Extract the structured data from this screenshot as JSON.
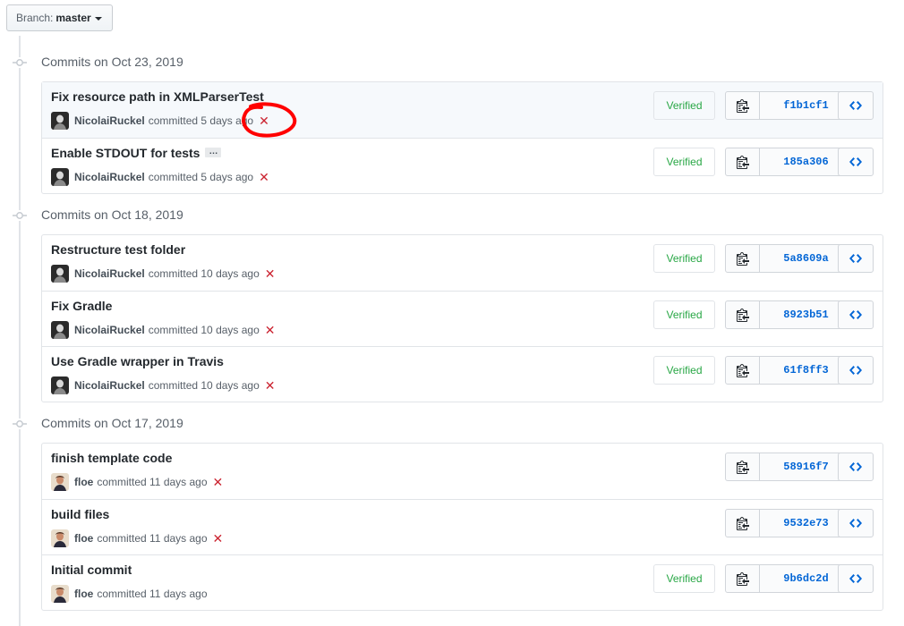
{
  "branch": {
    "prefix": "Branch:",
    "name": "master"
  },
  "groups": [
    {
      "title": "Commits on Oct 23, 2019",
      "commits": [
        {
          "message": "Fix resource path in XMLParserTest",
          "author": "NicolaiRuckel",
          "time": "committed 5 days ago",
          "failed": true,
          "verified": "Verified",
          "sha": "f1b1cf1",
          "avatar": "dark"
        },
        {
          "message": "Enable STDOUT for tests",
          "author": "NicolaiRuckel",
          "time": "committed 5 days ago",
          "failed": true,
          "verified": "Verified",
          "sha": "185a306",
          "avatar": "dark",
          "ellipsis": "…"
        }
      ]
    },
    {
      "title": "Commits on Oct 18, 2019",
      "commits": [
        {
          "message": "Restructure test folder",
          "author": "NicolaiRuckel",
          "time": "committed 10 days ago",
          "failed": true,
          "verified": "Verified",
          "sha": "5a8609a",
          "avatar": "dark"
        },
        {
          "message": "Fix Gradle",
          "author": "NicolaiRuckel",
          "time": "committed 10 days ago",
          "failed": true,
          "verified": "Verified",
          "sha": "8923b51",
          "avatar": "dark"
        },
        {
          "message": "Use Gradle wrapper in Travis",
          "author": "NicolaiRuckel",
          "time": "committed 10 days ago",
          "failed": true,
          "verified": "Verified",
          "sha": "61f8ff3",
          "avatar": "dark"
        }
      ]
    },
    {
      "title": "Commits on Oct 17, 2019",
      "commits": [
        {
          "message": "finish template code",
          "author": "floe",
          "time": "committed 11 days ago",
          "failed": true,
          "verified": "",
          "sha": "58916f7",
          "avatar": "light"
        },
        {
          "message": "build files",
          "author": "floe",
          "time": "committed 11 days ago",
          "failed": true,
          "verified": "",
          "sha": "9532e73",
          "avatar": "light"
        },
        {
          "message": "Initial commit",
          "author": "floe",
          "time": "committed 11 days ago",
          "failed": false,
          "verified": "Verified",
          "sha": "9b6dc2d",
          "avatar": "light"
        }
      ]
    }
  ],
  "icons": {
    "failure": "x-icon",
    "copy": "clippy-icon",
    "browse": "code-icon",
    "timeline": "git-commit-icon",
    "caret": "triangle-down-icon"
  },
  "colors": {
    "failure": "#cb2431",
    "verified": "#28a745",
    "sha": "#0366d6",
    "annotation": "#ff0000"
  }
}
